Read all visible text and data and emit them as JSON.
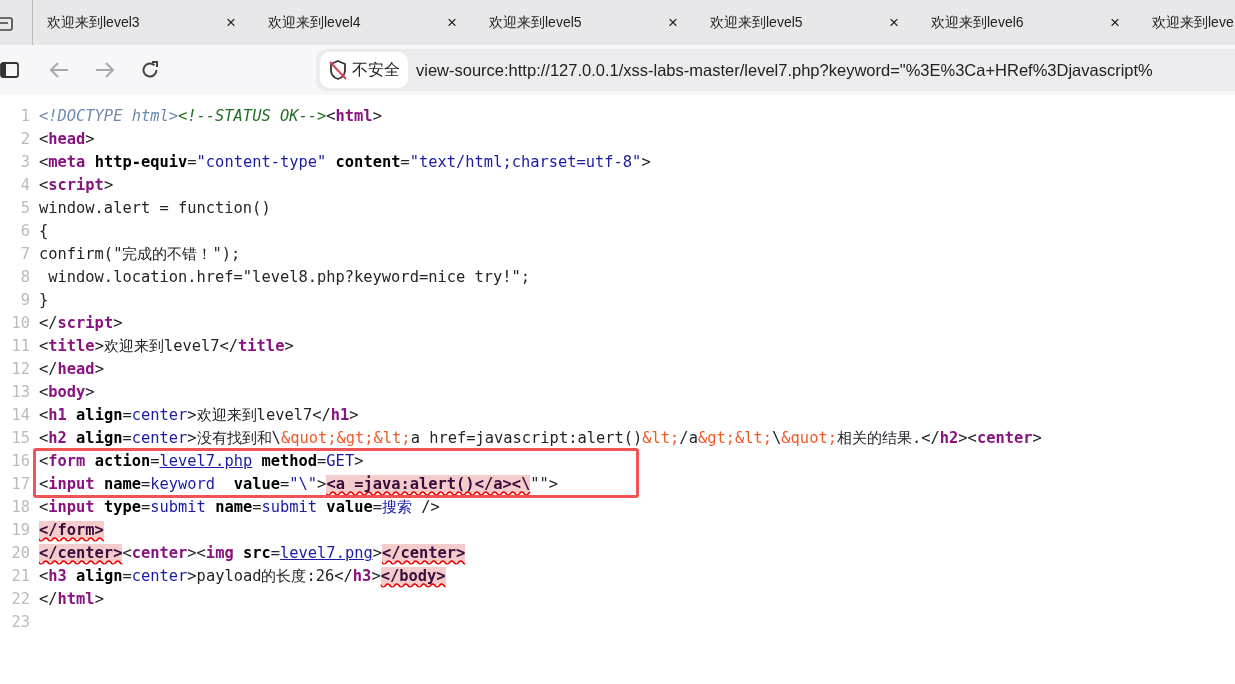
{
  "tabs": [
    {
      "title": "欢迎来到level3",
      "close": "×",
      "selected": false
    },
    {
      "title": "欢迎来到level4",
      "close": "×",
      "selected": false
    },
    {
      "title": "欢迎来到level5",
      "close": "×",
      "selected": false
    },
    {
      "title": "欢迎来到level5",
      "close": "×",
      "selected": false
    },
    {
      "title": "欢迎来到level6",
      "close": "×",
      "selected": false
    },
    {
      "title": "欢迎来到leve",
      "selected": false
    }
  ],
  "toolbar": {
    "back_disabled": true,
    "forward_disabled": true,
    "security_label": "不安全",
    "url": "view-source:http://127.0.0.1/xss-labs-master/level7.php?keyword=\"%3E%3Ca+HRef%3Djavascript%"
  },
  "source": {
    "lines": [
      {
        "number": "1",
        "framed": false,
        "tokens": [
          {
            "kind": "doctype",
            "text": "<!DOCTYPE html>"
          },
          {
            "kind": "comment",
            "text": "<!--STATUS OK-->"
          },
          {
            "kind": "punct",
            "text": "<"
          },
          {
            "kind": "tag",
            "text": "html"
          },
          {
            "kind": "punct",
            "text": ">"
          }
        ]
      },
      {
        "number": "2",
        "framed": false,
        "tokens": [
          {
            "kind": "punct",
            "text": "<"
          },
          {
            "kind": "tag",
            "text": "head"
          },
          {
            "kind": "punct",
            "text": ">"
          }
        ]
      },
      {
        "number": "3",
        "framed": false,
        "tokens": [
          {
            "kind": "punct",
            "text": "<"
          },
          {
            "kind": "tag",
            "text": "meta"
          },
          {
            "kind": "attr",
            "text": " http-equiv"
          },
          {
            "kind": "punct",
            "text": "="
          },
          {
            "kind": "value",
            "text": "\"content-type\""
          },
          {
            "kind": "attr",
            "text": " content"
          },
          {
            "kind": "punct",
            "text": "="
          },
          {
            "kind": "value",
            "text": "\"text/html;charset=utf-8\""
          },
          {
            "kind": "punct",
            "text": ">"
          }
        ]
      },
      {
        "number": "4",
        "framed": false,
        "tokens": [
          {
            "kind": "punct",
            "text": "<"
          },
          {
            "kind": "tag",
            "text": "script"
          },
          {
            "kind": "punct",
            "text": ">"
          }
        ]
      },
      {
        "number": "5",
        "framed": false,
        "tokens": [
          {
            "kind": "text",
            "text": "window.alert = function()"
          }
        ]
      },
      {
        "number": "6",
        "framed": false,
        "tokens": [
          {
            "kind": "text",
            "text": "{"
          }
        ]
      },
      {
        "number": "7",
        "framed": false,
        "tokens": [
          {
            "kind": "text",
            "text": "confirm(\"完成的不错！\");"
          }
        ]
      },
      {
        "number": "8",
        "framed": false,
        "tokens": [
          {
            "kind": "text",
            "text": " window.location.href=\"level8.php?keyword=nice try!\";"
          }
        ]
      },
      {
        "number": "9",
        "framed": false,
        "tokens": [
          {
            "kind": "text",
            "text": "}"
          }
        ]
      },
      {
        "number": "10",
        "framed": false,
        "tokens": [
          {
            "kind": "punct",
            "text": "</"
          },
          {
            "kind": "tag",
            "text": "script"
          },
          {
            "kind": "punct",
            "text": ">"
          }
        ]
      },
      {
        "number": "11",
        "framed": false,
        "tokens": [
          {
            "kind": "punct",
            "text": "<"
          },
          {
            "kind": "tag",
            "text": "title"
          },
          {
            "kind": "punct",
            "text": ">"
          },
          {
            "kind": "text",
            "text": "欢迎来到level7"
          },
          {
            "kind": "punct",
            "text": "</"
          },
          {
            "kind": "tag",
            "text": "title"
          },
          {
            "kind": "punct",
            "text": ">"
          }
        ]
      },
      {
        "number": "12",
        "framed": false,
        "tokens": [
          {
            "kind": "punct",
            "text": "</"
          },
          {
            "kind": "tag",
            "text": "head"
          },
          {
            "kind": "punct",
            "text": ">"
          }
        ]
      },
      {
        "number": "13",
        "framed": false,
        "tokens": [
          {
            "kind": "punct",
            "text": "<"
          },
          {
            "kind": "tag",
            "text": "body"
          },
          {
            "kind": "punct",
            "text": ">"
          }
        ]
      },
      {
        "number": "14",
        "framed": false,
        "tokens": [
          {
            "kind": "punct",
            "text": "<"
          },
          {
            "kind": "tag",
            "text": "h1"
          },
          {
            "kind": "attr",
            "text": " align"
          },
          {
            "kind": "punct",
            "text": "="
          },
          {
            "kind": "value",
            "text": "center"
          },
          {
            "kind": "punct",
            "text": ">"
          },
          {
            "kind": "text",
            "text": "欢迎来到level7"
          },
          {
            "kind": "punct",
            "text": "</"
          },
          {
            "kind": "tag",
            "text": "h1"
          },
          {
            "kind": "punct",
            "text": ">"
          }
        ]
      },
      {
        "number": "15",
        "framed": false,
        "tokens": [
          {
            "kind": "punct",
            "text": "<"
          },
          {
            "kind": "tag",
            "text": "h2"
          },
          {
            "kind": "attr",
            "text": " align"
          },
          {
            "kind": "punct",
            "text": "="
          },
          {
            "kind": "value",
            "text": "center"
          },
          {
            "kind": "punct",
            "text": ">"
          },
          {
            "kind": "text",
            "text": "没有找到和\\"
          },
          {
            "kind": "entity",
            "text": "&quot;&gt;&lt;"
          },
          {
            "kind": "text",
            "text": "a href=javascript:alert()"
          },
          {
            "kind": "entity",
            "text": "&lt;"
          },
          {
            "kind": "text",
            "text": "/a"
          },
          {
            "kind": "entity",
            "text": "&gt;&lt;"
          },
          {
            "kind": "text",
            "text": "\\"
          },
          {
            "kind": "entity",
            "text": "&quot;"
          },
          {
            "kind": "text",
            "text": "相关的结果."
          },
          {
            "kind": "punct",
            "text": "</"
          },
          {
            "kind": "tag",
            "text": "h2"
          },
          {
            "kind": "punct",
            "text": ">"
          },
          {
            "kind": "punct",
            "text": "<"
          },
          {
            "kind": "tag",
            "text": "center"
          },
          {
            "kind": "punct",
            "text": ">"
          }
        ]
      },
      {
        "number": "16",
        "framed": true,
        "tokens": [
          {
            "kind": "punct",
            "text": "<"
          },
          {
            "kind": "tag",
            "text": "form"
          },
          {
            "kind": "attr",
            "text": " action"
          },
          {
            "kind": "punct",
            "text": "="
          },
          {
            "kind": "link",
            "text": "level7.php"
          },
          {
            "kind": "attr",
            "text": " method"
          },
          {
            "kind": "punct",
            "text": "="
          },
          {
            "kind": "value",
            "text": "GET"
          },
          {
            "kind": "punct",
            "text": ">"
          }
        ]
      },
      {
        "number": "17",
        "framed": true,
        "tokens": [
          {
            "kind": "punct",
            "text": "<"
          },
          {
            "kind": "tag",
            "text": "input"
          },
          {
            "kind": "attr",
            "text": " name"
          },
          {
            "kind": "punct",
            "text": "="
          },
          {
            "kind": "value",
            "text": "keyword"
          },
          {
            "kind": "attr",
            "text": "  value"
          },
          {
            "kind": "punct",
            "text": "="
          },
          {
            "kind": "value",
            "text": "\"\\\""
          },
          {
            "kind": "punct",
            "text": ">"
          },
          {
            "kind": "error",
            "text": "<a =java:alert()</a><\\"
          },
          {
            "kind": "punct",
            "text": "\"\">"
          }
        ]
      },
      {
        "number": "18",
        "framed": false,
        "tokens": [
          {
            "kind": "punct",
            "text": "<"
          },
          {
            "kind": "tag",
            "text": "input"
          },
          {
            "kind": "attr",
            "text": " type"
          },
          {
            "kind": "punct",
            "text": "="
          },
          {
            "kind": "value",
            "text": "submit"
          },
          {
            "kind": "attr",
            "text": " name"
          },
          {
            "kind": "punct",
            "text": "="
          },
          {
            "kind": "value",
            "text": "submit"
          },
          {
            "kind": "attr",
            "text": " value"
          },
          {
            "kind": "punct",
            "text": "="
          },
          {
            "kind": "value",
            "text": "搜索"
          },
          {
            "kind": "punct",
            "text": " />"
          }
        ]
      },
      {
        "number": "19",
        "framed": false,
        "tokens": [
          {
            "kind": "error",
            "text": "</form>"
          }
        ]
      },
      {
        "number": "20",
        "framed": false,
        "tokens": [
          {
            "kind": "error",
            "text": "</center>"
          },
          {
            "kind": "punct",
            "text": "<"
          },
          {
            "kind": "tag",
            "text": "center"
          },
          {
            "kind": "punct",
            "text": ">"
          },
          {
            "kind": "punct",
            "text": "<"
          },
          {
            "kind": "tag",
            "text": "img"
          },
          {
            "kind": "attr",
            "text": " src"
          },
          {
            "kind": "punct",
            "text": "="
          },
          {
            "kind": "link",
            "text": "level7.png"
          },
          {
            "kind": "punct",
            "text": ">"
          },
          {
            "kind": "error",
            "text": "</center>"
          }
        ]
      },
      {
        "number": "21",
        "framed": false,
        "tokens": [
          {
            "kind": "punct",
            "text": "<"
          },
          {
            "kind": "tag",
            "text": "h3"
          },
          {
            "kind": "attr",
            "text": " align"
          },
          {
            "kind": "punct",
            "text": "="
          },
          {
            "kind": "value",
            "text": "center"
          },
          {
            "kind": "punct",
            "text": ">"
          },
          {
            "kind": "text",
            "text": "payload的长度:26"
          },
          {
            "kind": "punct",
            "text": "</"
          },
          {
            "kind": "tag",
            "text": "h3"
          },
          {
            "kind": "punct",
            "text": ">"
          },
          {
            "kind": "error",
            "text": "</body>"
          }
        ]
      },
      {
        "number": "22",
        "framed": false,
        "tokens": [
          {
            "kind": "punct",
            "text": "</"
          },
          {
            "kind": "tag",
            "text": "html"
          },
          {
            "kind": "punct",
            "text": ">"
          }
        ]
      },
      {
        "number": "23",
        "framed": false
      }
    ]
  }
}
